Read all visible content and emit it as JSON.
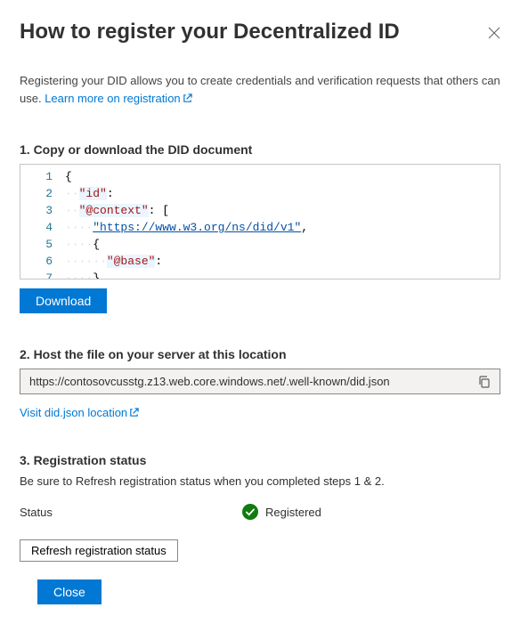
{
  "header": {
    "title": "How to register your Decentralized ID"
  },
  "intro": {
    "text": "Registering your DID allows you to create credentials and verification requests that others can use. ",
    "link_label": "Learn more on registration"
  },
  "step1": {
    "heading": "1. Copy or download the DID document",
    "download_label": "Download",
    "code": {
      "lines": [
        {
          "n": 1,
          "indent": "",
          "tokens": [
            {
              "t": "{",
              "c": "pun"
            }
          ]
        },
        {
          "n": 2,
          "indent": "··",
          "tokens": [
            {
              "t": "\"id\"",
              "c": "key"
            },
            {
              "t": ":",
              "c": "pun"
            }
          ]
        },
        {
          "n": 3,
          "indent": "··",
          "tokens": [
            {
              "t": "\"@context\"",
              "c": "key"
            },
            {
              "t": ": [",
              "c": "pun"
            }
          ]
        },
        {
          "n": 4,
          "indent": "····",
          "tokens": [
            {
              "t": "\"https://www.w3.org/ns/did/v1\"",
              "c": "str"
            },
            {
              "t": ",",
              "c": "pun"
            }
          ]
        },
        {
          "n": 5,
          "indent": "····",
          "tokens": [
            {
              "t": "{",
              "c": "pun"
            }
          ]
        },
        {
          "n": 6,
          "indent": "······",
          "tokens": [
            {
              "t": "\"@base\"",
              "c": "key"
            },
            {
              "t": ":",
              "c": "pun"
            }
          ]
        },
        {
          "n": 7,
          "indent": "····",
          "tokens": [
            {
              "t": "}",
              "c": "pun"
            }
          ]
        }
      ]
    }
  },
  "step2": {
    "heading": "2. Host the file on your server at this location",
    "location_value": "https://contosovcusstg.z13.web.core.windows.net/.well-known/did.json",
    "visit_link_label": "Visit did.json location"
  },
  "step3": {
    "heading": "3. Registration status",
    "description": "Be sure to Refresh registration status when you completed steps 1 & 2.",
    "status_label": "Status",
    "status_value": "Registered",
    "refresh_label": "Refresh registration status"
  },
  "footer": {
    "close_label": "Close"
  }
}
